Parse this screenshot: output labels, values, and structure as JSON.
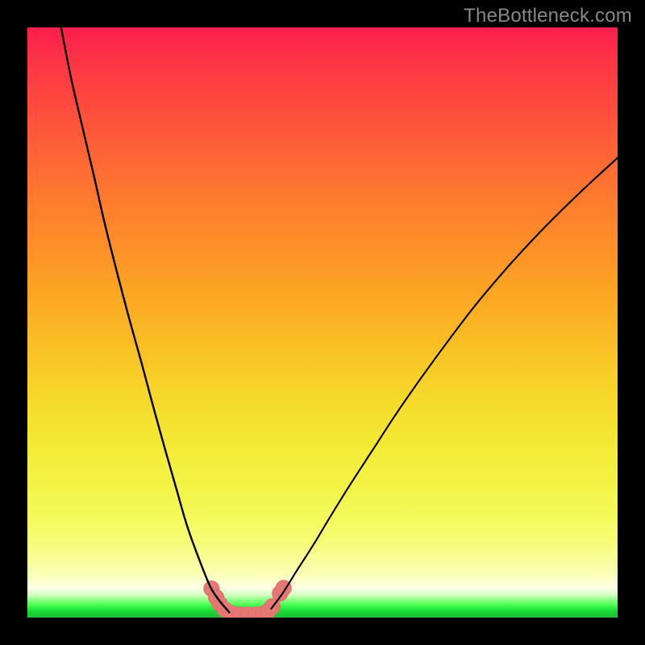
{
  "watermark": "TheBottleneck.com",
  "colors": {
    "curve": "#000000",
    "marker_fill": "#e57873",
    "marker_stroke": "#d9645f",
    "frame": "#000000"
  },
  "chart_data": {
    "type": "line",
    "title": "",
    "xlabel": "",
    "ylabel": "",
    "x_range": [
      0,
      100
    ],
    "y_range": [
      0,
      100
    ],
    "note": "Axes are unlabeled; values below are estimated from pixel positions as percentages of the plot area (x left→right, y bottom→top). The chart depicts a bottleneck curve (V-shape) with the minimum near x≈35–38, y≈0.",
    "series": [
      {
        "name": "left-branch",
        "x": [
          5.7,
          7.4,
          9.3,
          11.3,
          13.0,
          15.0,
          17.1,
          19.3,
          21.2,
          23.3,
          25.3,
          27.1,
          29.2,
          31.0,
          32.5,
          34.2
        ],
        "y": [
          100.0,
          91.4,
          83.2,
          74.7,
          67.2,
          59.2,
          51.2,
          43.3,
          36.2,
          28.6,
          21.6,
          15.4,
          9.6,
          5.2,
          2.9,
          0.9
        ]
      },
      {
        "name": "right-branch",
        "x": [
          41.3,
          43.3,
          45.8,
          48.5,
          51.2,
          54.6,
          58.5,
          62.4,
          66.7,
          71.3,
          75.8,
          80.5,
          85.4,
          90.4,
          95.2,
          100.0
        ],
        "y": [
          1.5,
          4.2,
          8.2,
          12.4,
          16.9,
          22.4,
          28.4,
          34.4,
          40.6,
          46.9,
          52.8,
          58.4,
          63.8,
          68.9,
          73.5,
          77.9
        ]
      }
    ],
    "markers": {
      "name": "bottom-highlight",
      "points_xy": [
        [
          31.2,
          4.9
        ],
        [
          32.0,
          3.4
        ],
        [
          32.6,
          2.3
        ],
        [
          33.4,
          1.4
        ],
        [
          34.7,
          0.7
        ],
        [
          36.1,
          0.5
        ],
        [
          37.4,
          0.5
        ],
        [
          38.7,
          0.5
        ],
        [
          40.0,
          0.7
        ],
        [
          40.8,
          1.1
        ],
        [
          41.5,
          1.9
        ],
        [
          42.8,
          4.1
        ],
        [
          43.4,
          5.0
        ]
      ],
      "radius_pct": 1.35
    }
  }
}
